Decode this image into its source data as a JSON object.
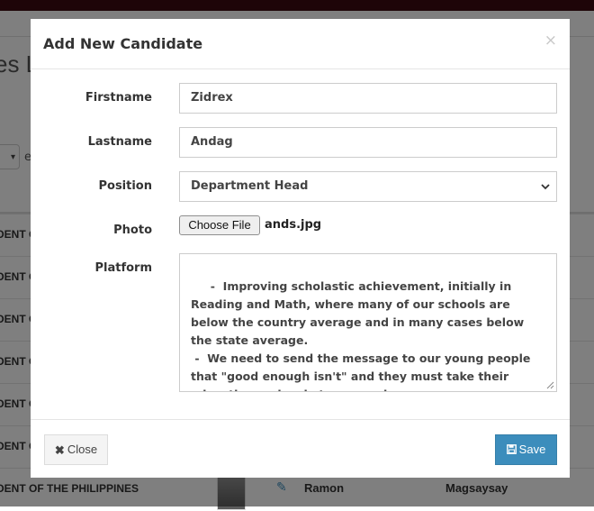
{
  "background": {
    "page_title": "es L",
    "entries_select_value": "",
    "entries_label": "e",
    "rows": [
      {
        "position": "DENT O",
        "firstname": "",
        "lastname": ""
      },
      {
        "position": "DENT O",
        "firstname": "",
        "lastname": ""
      },
      {
        "position": "DENT O",
        "firstname": "",
        "lastname": ""
      },
      {
        "position": "DENT O",
        "firstname": "",
        "lastname": ""
      },
      {
        "position": "DENT O",
        "firstname": "",
        "lastname": ""
      },
      {
        "position": "DENT O",
        "firstname": "",
        "lastname": ""
      },
      {
        "position": "DENT OF THE PHILIPPINES",
        "firstname": "Ramon",
        "lastname": "Magsaysay"
      }
    ],
    "edit_icon": "edit-icon",
    "colors": {
      "topbar": "#3d0a10",
      "link": "#3c8dbc"
    }
  },
  "modal": {
    "title": "Add New Candidate",
    "close_symbol": "×",
    "fields": {
      "firstname": {
        "label": "Firstname",
        "value": "Zidrex"
      },
      "lastname": {
        "label": "Lastname",
        "value": "Andag"
      },
      "position": {
        "label": "Position",
        "selected": "Department Head"
      },
      "photo": {
        "label": "Photo",
        "button_label": "Choose File",
        "file_name": "ands.jpg"
      },
      "platform": {
        "label": "Platform",
        "value": " -  Improving scholastic achievement, initially in Reading and Math, where many of our schools are below the country average and in many cases below the state average.\n -  We need to send the message to our young people that \"good enough isn't\" and they must take their education seriously to succeed.\n -  Promote Volunteerism."
      }
    },
    "footer": {
      "close_label": "Close",
      "close_icon": "times-icon",
      "save_label": "Save",
      "save_icon": "floppy-disk-icon"
    },
    "colors": {
      "primary": "#3c8dbc",
      "default_btn": "#f4f4f4"
    }
  }
}
